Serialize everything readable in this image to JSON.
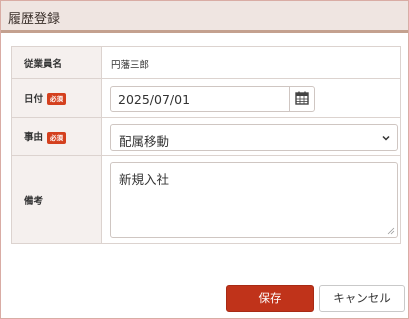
{
  "dialog": {
    "title": "履歴登録"
  },
  "form": {
    "employee": {
      "label": "従業員名",
      "value": "円藩三郎"
    },
    "date": {
      "label": "日付",
      "required_badge": "必須",
      "value": "2025/07/01",
      "icon": "calendar-icon"
    },
    "reason": {
      "label": "事由",
      "required_badge": "必須",
      "value": "配属移動",
      "icon": "chevron-down-icon"
    },
    "note": {
      "label": "備考",
      "value": "新規入社"
    }
  },
  "buttons": {
    "save": "保存",
    "cancel": "キャンセル"
  },
  "colors": {
    "header_bg": "#efe5e1",
    "accent": "#c0331a",
    "required_badge": "#d4401e",
    "label_bg": "#f5f0ee"
  }
}
